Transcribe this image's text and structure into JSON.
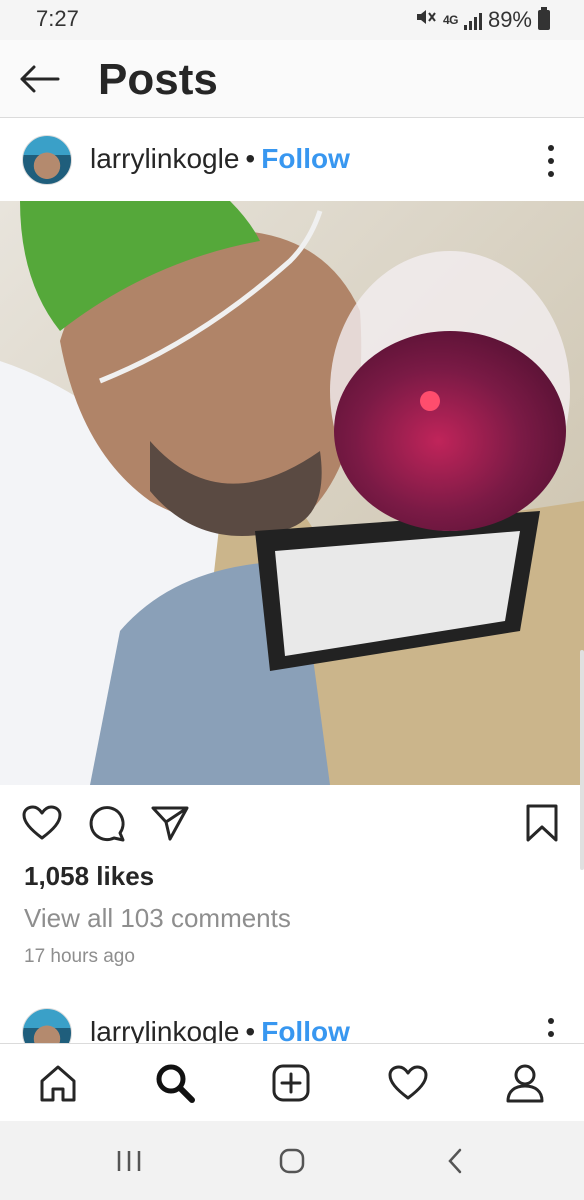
{
  "status_bar": {
    "time": "7:27",
    "network": "4G",
    "battery": "89%"
  },
  "header": {
    "title": "Posts"
  },
  "posts": [
    {
      "username": "larrylinkogle",
      "separator": "•",
      "follow_label": "Follow"
    },
    {
      "username": "larrylinkogle",
      "separator": "•",
      "follow_label": "Follow"
    }
  ],
  "post_footer": {
    "likes": "1,058 likes",
    "view_comments": "View all 103 comments",
    "timestamp": "17 hours ago"
  },
  "icons": {
    "back": "arrow-left-icon",
    "more": "more-vertical-icon",
    "like": "heart-icon",
    "comment": "comment-icon",
    "share": "paper-plane-icon",
    "save": "bookmark-icon",
    "nav": [
      "home-icon",
      "search-icon",
      "add-post-icon",
      "activity-heart-icon",
      "profile-icon"
    ],
    "system": [
      "recent-apps-icon",
      "home-circle-icon",
      "back-chevron-icon"
    ]
  },
  "colors": {
    "follow": "#3897f0",
    "text": "#262626",
    "secondary": "#8e8e8e"
  }
}
